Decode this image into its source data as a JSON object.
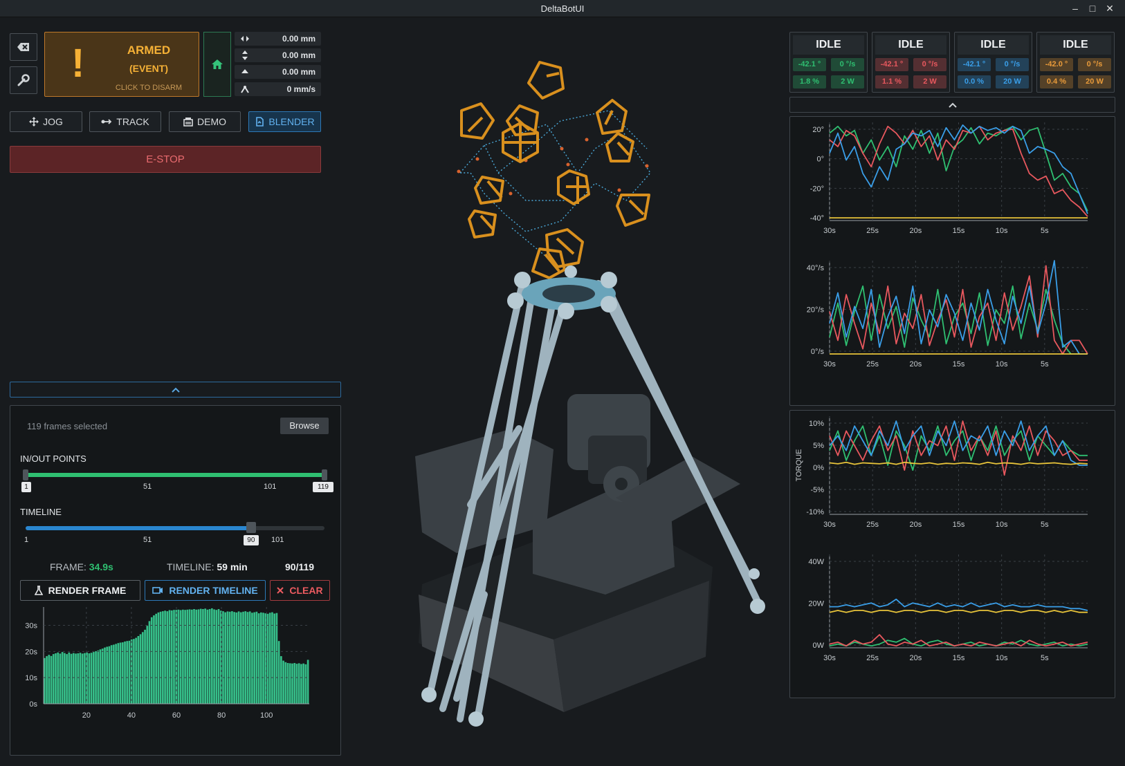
{
  "window": {
    "title": "DeltaBotUI"
  },
  "arm": {
    "state": "ARMED",
    "sub": "(EVENT)",
    "hint": "CLICK TO DISARM"
  },
  "readouts": [
    {
      "icon": "x-axis-icon",
      "value": "0.00 mm"
    },
    {
      "icon": "y-axis-icon",
      "value": "0.00 mm"
    },
    {
      "icon": "z-axis-icon",
      "value": "0.00 mm"
    },
    {
      "icon": "speed-icon",
      "value": "0 mm/s"
    }
  ],
  "modes": [
    {
      "label": "JOG",
      "icon": "move-icon",
      "active": false
    },
    {
      "label": "TRACK",
      "icon": "track-icon",
      "active": false
    },
    {
      "label": "DEMO",
      "icon": "demo-icon",
      "active": false
    },
    {
      "label": "BLENDER",
      "icon": "blender-icon",
      "active": true
    }
  ],
  "estop": {
    "label": "E-STOP"
  },
  "blender": {
    "frames_selected": "119 frames selected",
    "browse": "Browse",
    "inout_title": "IN/OUT POINTS",
    "inout_ticks": [
      "51",
      "101"
    ],
    "inout_in": "1",
    "inout_out": "119",
    "inout_range": [
      1,
      119
    ],
    "timeline_title": "TIMELINE",
    "timeline_ticks": [
      "1",
      "51",
      "101"
    ],
    "timeline_value": "90",
    "timeline_position": 90,
    "frame_label": "FRAME:",
    "frame_value": "34.9s",
    "timeline_label": "TIMELINE:",
    "timeline_total": "59 min",
    "counter": "90/119",
    "render_frame": "RENDER FRAME",
    "render_timeline": "RENDER TIMELINE",
    "clear": "CLEAR"
  },
  "motors": [
    {
      "state": "IDLE",
      "angle": "-42.1 °",
      "speed": "0 °/s",
      "load": "1.8 %",
      "power": "2 W",
      "color": "#2fbf71"
    },
    {
      "state": "IDLE",
      "angle": "-42.1 °",
      "speed": "0 °/s",
      "load": "1.1 %",
      "power": "2 W",
      "color": "#e8585e"
    },
    {
      "state": "IDLE",
      "angle": "-42.1 °",
      "speed": "0 °/s",
      "load": "0.0 %",
      "power": "20 W",
      "color": "#3a9ee8"
    },
    {
      "state": "IDLE",
      "angle": "-42.0 °",
      "speed": "0 °/s",
      "load": "0.4 %",
      "power": "20 W",
      "color": "#e89a3a"
    }
  ],
  "chart_data": [
    {
      "type": "line",
      "title": "",
      "ylabel": "",
      "x_ticks": [
        "30s",
        "25s",
        "20s",
        "15s",
        "10s",
        "5s"
      ],
      "y_ticks": [
        "20°",
        "0°",
        "-20°",
        "-40°"
      ],
      "ylim": [
        -45,
        28
      ],
      "series": [
        {
          "color": "#2fbf71",
          "values": [
            20,
            25,
            18,
            22,
            5,
            15,
            0,
            10,
            -5,
            18,
            8,
            22,
            5,
            20,
            -8,
            10,
            15,
            24,
            12,
            20,
            18,
            22,
            25,
            15,
            22,
            24,
            5,
            -15,
            -10,
            -20,
            -25,
            -38
          ]
        },
        {
          "color": "#e8585e",
          "values": [
            15,
            10,
            22,
            18,
            5,
            -5,
            12,
            25,
            20,
            12,
            22,
            10,
            18,
            0,
            15,
            8,
            22,
            20,
            25,
            15,
            20,
            22,
            23,
            5,
            -10,
            -15,
            -12,
            -25,
            -22,
            -30,
            -35,
            -42
          ]
        },
        {
          "color": "#3a9ee8",
          "values": [
            5,
            20,
            0,
            10,
            -10,
            -20,
            -5,
            -15,
            8,
            12,
            20,
            18,
            22,
            10,
            24,
            15,
            26,
            20,
            25,
            22,
            24,
            20,
            25,
            22,
            5,
            10,
            8,
            5,
            -5,
            -10,
            -25,
            -40
          ]
        },
        {
          "color": "#e8c43a",
          "values": [
            -43,
            -43,
            -43,
            -43,
            -43,
            -43,
            -43,
            -43,
            -43,
            -43,
            -43,
            -43,
            -43,
            -43,
            -43,
            -43,
            -43,
            -43,
            -43,
            -43,
            -43,
            -43,
            -43,
            -43,
            -43,
            -43,
            -43,
            -43,
            -43,
            -43,
            -43,
            -43
          ]
        }
      ]
    },
    {
      "type": "line",
      "title": "",
      "ylabel": "",
      "x_ticks": [
        "30s",
        "25s",
        "20s",
        "15s",
        "10s",
        "5s"
      ],
      "y_ticks": [
        "40°/s",
        "20°/s",
        "0°/s"
      ],
      "ylim": [
        0,
        55
      ],
      "series": [
        {
          "color": "#2fbf71",
          "values": [
            10,
            30,
            5,
            25,
            40,
            8,
            35,
            15,
            28,
            4,
            33,
            20,
            10,
            38,
            6,
            22,
            30,
            12,
            36,
            5,
            26,
            18,
            40,
            9,
            30,
            14,
            38,
            20,
            6,
            0,
            0,
            0
          ]
        },
        {
          "color": "#e8585e",
          "values": [
            25,
            8,
            35,
            18,
            3,
            30,
            12,
            40,
            6,
            24,
            15,
            35,
            5,
            20,
            32,
            10,
            38,
            4,
            22,
            30,
            8,
            36,
            14,
            28,
            46,
            10,
            52,
            8,
            0,
            8,
            8,
            0
          ]
        },
        {
          "color": "#3a9ee8",
          "values": [
            18,
            36,
            10,
            28,
            15,
            38,
            4,
            22,
            34,
            12,
            40,
            6,
            26,
            16,
            35,
            24,
            8,
            30,
            14,
            38,
            20,
            6,
            34,
            18,
            40,
            12,
            30,
            55,
            4,
            8,
            0,
            0
          ]
        },
        {
          "color": "#e8c43a",
          "values": [
            0,
            0,
            0,
            0,
            0,
            0,
            0,
            0,
            0,
            0,
            0,
            0,
            0,
            0,
            0,
            0,
            0,
            0,
            0,
            0,
            0,
            0,
            0,
            0,
            0,
            0,
            0,
            0,
            0,
            0,
            0,
            0
          ]
        }
      ]
    },
    {
      "type": "line",
      "title": "",
      "ylabel": "TORQUE",
      "x_ticks": [
        "30s",
        "25s",
        "20s",
        "15s",
        "10s",
        "5s"
      ],
      "y_ticks": [
        "10%",
        "5%",
        "0%",
        "-5%",
        "-10%"
      ],
      "ylim": [
        -10,
        10
      ],
      "series": [
        {
          "color": "#2fbf71",
          "values": [
            3,
            7,
            1,
            5,
            8,
            2,
            6,
            0,
            7,
            4,
            -1,
            6,
            3,
            8,
            2,
            5,
            7,
            1,
            6,
            3,
            8,
            2,
            5,
            7,
            1,
            6,
            4,
            2,
            5,
            3,
            2,
            2
          ]
        },
        {
          "color": "#e8585e",
          "values": [
            6,
            2,
            7,
            4,
            1,
            5,
            8,
            3,
            6,
            -1,
            7,
            2,
            5,
            4,
            8,
            1,
            9,
            3,
            6,
            2,
            7,
            -2,
            6,
            3,
            8,
            2,
            7,
            5,
            2,
            3,
            1,
            1
          ]
        },
        {
          "color": "#3a9ee8",
          "values": [
            4,
            6,
            3,
            8,
            5,
            2,
            7,
            4,
            9,
            3,
            6,
            8,
            2,
            7,
            4,
            9,
            3,
            6,
            5,
            8,
            2,
            7,
            4,
            9,
            3,
            6,
            8,
            2,
            5,
            1,
            0,
            0
          ]
        },
        {
          "color": "#e8c43a",
          "values": [
            0.5,
            0.3,
            0.6,
            0.2,
            0.5,
            0.4,
            0.3,
            0.5,
            0.2,
            0.6,
            0.4,
            0.3,
            0.5,
            0.2,
            0.4,
            0.3,
            0.5,
            0.4,
            0.2,
            0.6,
            0.3,
            0.5,
            0.4,
            0.2,
            0.5,
            0.3,
            0.4,
            0.5,
            0.3,
            0.2,
            0.4,
            0.3
          ]
        }
      ]
    },
    {
      "type": "line",
      "title": "",
      "ylabel": "",
      "x_ticks": [
        "30s",
        "25s",
        "20s",
        "15s",
        "10s",
        "5s"
      ],
      "y_ticks": [
        "40W",
        "20W",
        "0W"
      ],
      "ylim": [
        0,
        50
      ],
      "series": [
        {
          "color": "#3a9ee8",
          "values": [
            22,
            22,
            23,
            22,
            23,
            24,
            22,
            23,
            26,
            22,
            24,
            23,
            22,
            24,
            22,
            23,
            22,
            24,
            22,
            23,
            24,
            22,
            23,
            22,
            22,
            23,
            22,
            22,
            22,
            21,
            21,
            20
          ]
        },
        {
          "color": "#e8c43a",
          "values": [
            19,
            20,
            19,
            20,
            20,
            19,
            20,
            20,
            19,
            20,
            20,
            19,
            20,
            20,
            19,
            20,
            20,
            19,
            20,
            20,
            19,
            20,
            20,
            19,
            20,
            20,
            19,
            20,
            19,
            20,
            19,
            19
          ]
        },
        {
          "color": "#2fbf71",
          "values": [
            1,
            2,
            1,
            3,
            2,
            1,
            2,
            4,
            3,
            5,
            2,
            1,
            3,
            4,
            2,
            1,
            2,
            3,
            1,
            2,
            1,
            3,
            2,
            4,
            2,
            1,
            2,
            3,
            1,
            2,
            1,
            2
          ]
        },
        {
          "color": "#e8585e",
          "values": [
            2,
            3,
            1,
            4,
            2,
            3,
            7,
            2,
            1,
            3,
            2,
            4,
            1,
            2,
            3,
            1,
            2,
            1,
            3,
            2,
            1,
            2,
            3,
            1,
            4,
            2,
            1,
            2,
            3,
            1,
            2,
            3
          ]
        }
      ]
    },
    {
      "type": "bar",
      "title": "",
      "ylabel": "",
      "x_ticks": [
        "20",
        "40",
        "60",
        "80",
        "100"
      ],
      "y_ticks": [
        "30s",
        "20s",
        "10s",
        "0s"
      ],
      "ylim": [
        0,
        37
      ],
      "x_range": [
        1,
        119
      ],
      "values": [
        17.5,
        18.2,
        18.7,
        18.3,
        19.0,
        19.3,
        19.6,
        19.2,
        19.8,
        19.4,
        19.0,
        19.6,
        19.1,
        19.4,
        19.2,
        19.3,
        19.5,
        19.2,
        19.4,
        19.6,
        19.3,
        19.5,
        19.8,
        20.1,
        20.4,
        20.8,
        21.1,
        21.5,
        21.8,
        22.0,
        22.4,
        22.6,
        22.9,
        23.2,
        23.4,
        23.5,
        23.8,
        24.0,
        24.1,
        24.6,
        24.8,
        25.2,
        25.9,
        26.6,
        27.4,
        28.3,
        29.8,
        31.6,
        33.1,
        33.8,
        34.4,
        34.9,
        35.2,
        35.4,
        35.6,
        35.4,
        35.8,
        35.7,
        35.9,
        35.9,
        36.0,
        35.8,
        36.0,
        35.9,
        36.0,
        36.1,
        36.0,
        36.2,
        36.0,
        36.1,
        36.3,
        36.2,
        36.4,
        36.0,
        36.2,
        36.5,
        36.1,
        35.9,
        36.2,
        35.6,
        35.4,
        35.0,
        35.3,
        35.2,
        35.4,
        35.1,
        34.9,
        35.3,
        35.0,
        35.2,
        35.4,
        35.1,
        35.3,
        34.8,
        35.0,
        35.2,
        34.6,
        34.9,
        34.8,
        34.6,
        34.4,
        34.8,
        35.0,
        34.5,
        34.7,
        24.0,
        18.2,
        16.5,
        15.9,
        15.6,
        15.5,
        15.4,
        15.6,
        15.3,
        15.5,
        15.2,
        15.4,
        15.1,
        16.8
      ]
    }
  ]
}
